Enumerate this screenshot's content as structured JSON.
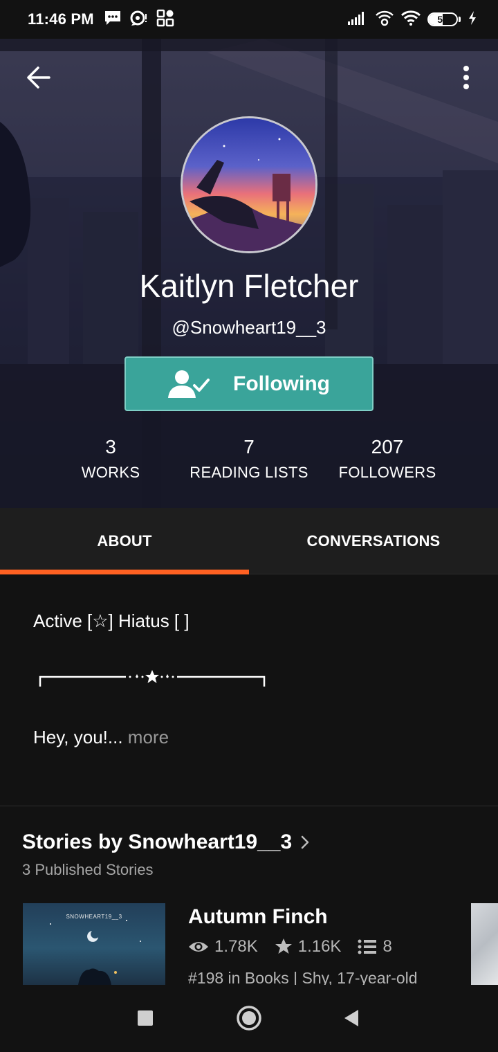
{
  "status_bar": {
    "time": "11:46 PM",
    "battery_level": "50",
    "battery_fraction": 0.5,
    "icons": [
      "message-icon",
      "chat-icon",
      "app-grid-icon",
      "signal-icon",
      "wifi-calling-icon",
      "wifi-icon",
      "battery-icon",
      "charging-icon"
    ]
  },
  "profile": {
    "display_name": "Kaitlyn Fletcher",
    "username": "@Snowheart19__3",
    "follow_button_label": "Following",
    "stats": [
      {
        "value": "3",
        "label": "WORKS"
      },
      {
        "value": "7",
        "label": "READING LISTS"
      },
      {
        "value": "207",
        "label": "FOLLOWERS"
      }
    ]
  },
  "tabs": [
    {
      "label": "ABOUT",
      "active": true
    },
    {
      "label": "CONVERSATIONS",
      "active": false
    }
  ],
  "about": {
    "status_line": "Active [☆] Hiatus [ ]",
    "greeting": "Hey, you!...",
    "more_label": " more"
  },
  "stories": {
    "title": "Stories by Snowheart19__3",
    "subtitle": "3 Published Stories",
    "items": [
      {
        "cover_author": "SNOWHEART19__3",
        "title": "Autumn Finch",
        "reads": "1.78K",
        "votes": "1.16K",
        "parts": "8",
        "rank": "#198 in Books | Shy, 17-year-old"
      }
    ]
  },
  "colors": {
    "accent": "#ff6122",
    "follow_button": "#3aa49a",
    "background": "#121212",
    "tab_bar": "#1e1e1e"
  }
}
